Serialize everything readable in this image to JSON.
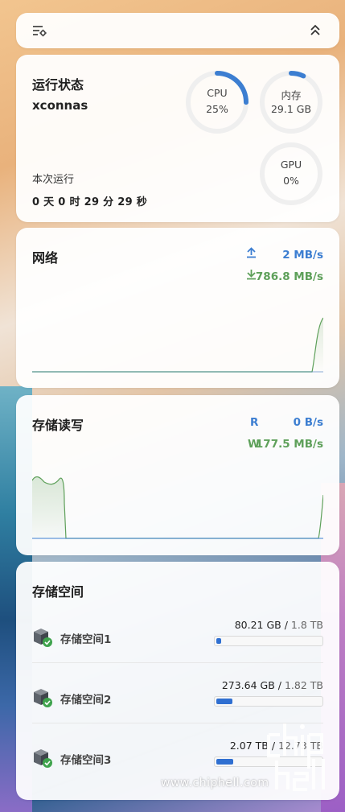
{
  "status": {
    "title": "运行状态",
    "hostname": "xconnas",
    "uptime_label": "本次运行",
    "uptime_value": "0 天 0 时 29 分 29 秒",
    "gauges": [
      {
        "name": "CPU",
        "value_text": "25%",
        "fraction": 0.25
      },
      {
        "name": "内存",
        "value_text": "29.1 GB",
        "fraction": 0.07
      },
      {
        "name": "GPU",
        "value_text": "0%",
        "fraction": 0
      }
    ]
  },
  "network": {
    "title": "网络",
    "upload": "2 MB/s",
    "download": "786.8 MB/s",
    "upload_icon": "upload-arrow-icon",
    "download_icon": "download-arrow-icon"
  },
  "disk_io": {
    "title": "存储读写",
    "read_label": "R",
    "read_value": "0 B/s",
    "write_label": "W",
    "write_value": "177.5 MB/s"
  },
  "storage": {
    "title": "存储空间",
    "pools": [
      {
        "name": "存储空间1",
        "used": "80.21 GB",
        "total": "1.8 TB",
        "fraction": 0.04
      },
      {
        "name": "存储空间2",
        "used": "273.64 GB",
        "total": "1.82 TB",
        "fraction": 0.15
      },
      {
        "name": "存储空间3",
        "used": "2.07 TB",
        "total": "12.73 TB",
        "fraction": 0.16
      }
    ]
  },
  "watermark": {
    "url": "www.chiphell.com",
    "logo": "chiphell"
  },
  "colors": {
    "accent_blue": "#3c7ed1",
    "accent_green": "#5ea05a",
    "bar_blue": "#2f6fd1"
  }
}
